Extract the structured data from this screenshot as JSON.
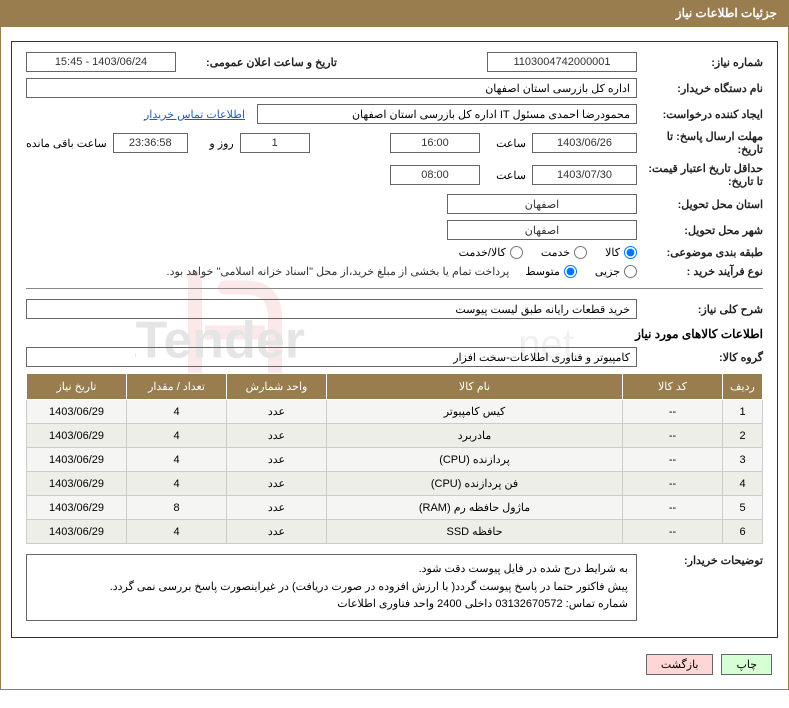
{
  "title_bar": "جزئیات اطلاعات نیاز",
  "labels": {
    "need_no": "شماره نیاز:",
    "announce_dt": "تاریخ و ساعت اعلان عمومی:",
    "buyer_org": "نام دستگاه خریدار:",
    "requester": "ایجاد کننده درخواست:",
    "contact_link": "اطلاعات تماس خریدار",
    "reply_deadline": "مهلت ارسال پاسخ: تا تاریخ:",
    "hour": "ساعت",
    "day_and": "روز و",
    "remaining": "ساعت باقی مانده",
    "price_valid": "حداقل تاریخ اعتبار قیمت: تا تاریخ:",
    "delivery_prov": "استان محل تحویل:",
    "delivery_city": "شهر محل تحویل:",
    "category": "طبقه بندی موضوعی:",
    "purchase_type": "نوع فرآیند خرید :",
    "purchase_note": "پرداخت تمام یا بخشی از مبلغ خرید،از محل \"اسناد خزانه اسلامی\" خواهد بود.",
    "general_desc": "شرح کلی نیاز:",
    "items_title": "اطلاعات کالاهای مورد نیاز",
    "goods_group": "گروه کالا:",
    "buyer_notes": "توضیحات خریدار:"
  },
  "values": {
    "need_no": "1103004742000001",
    "announce_dt": "1403/06/24 - 15:45",
    "buyer_org": "اداره کل بازرسی استان اصفهان",
    "requester": "محمودرضا احمدی مسئول IT اداره کل بازرسی استان اصفهان",
    "reply_date": "1403/06/26",
    "reply_hour": "16:00",
    "remain_days": "1",
    "remain_time": "23:36:58",
    "valid_date": "1403/07/30",
    "valid_hour": "08:00",
    "delivery_prov": "اصفهان",
    "delivery_city": "اصفهان",
    "general_desc": "خرید قطعات رایانه طبق لیست پیوست",
    "goods_group": "کامپیوتر و فناوری اطلاعات-سخت افزار"
  },
  "radios": {
    "category": {
      "options": [
        "کالا",
        "خدمت",
        "کالا/خدمت"
      ],
      "selected": 0
    },
    "purchase_type": {
      "options": [
        "جزیی",
        "متوسط"
      ],
      "selected": 1
    }
  },
  "table": {
    "headers": [
      "ردیف",
      "کد کالا",
      "نام کالا",
      "واحد شمارش",
      "تعداد / مقدار",
      "تاریخ نیاز"
    ],
    "rows": [
      {
        "n": "1",
        "code": "--",
        "name": "کیس کامپیوتر",
        "unit": "عدد",
        "qty": "4",
        "date": "1403/06/29"
      },
      {
        "n": "2",
        "code": "--",
        "name": "مادربرد",
        "unit": "عدد",
        "qty": "4",
        "date": "1403/06/29"
      },
      {
        "n": "3",
        "code": "--",
        "name": "پردازنده (CPU)",
        "unit": "عدد",
        "qty": "4",
        "date": "1403/06/29"
      },
      {
        "n": "4",
        "code": "--",
        "name": "فن پردازنده (CPU)",
        "unit": "عدد",
        "qty": "4",
        "date": "1403/06/29"
      },
      {
        "n": "5",
        "code": "--",
        "name": "ماژول حافظه رم (RAM)",
        "unit": "عدد",
        "qty": "8",
        "date": "1403/06/29"
      },
      {
        "n": "6",
        "code": "--",
        "name": "حافظه SSD",
        "unit": "عدد",
        "qty": "4",
        "date": "1403/06/29"
      }
    ]
  },
  "buyer_notes_lines": [
    "به شرایط درج شده در فایل پیوست دقت شود.",
    "پیش فاکتور حتما در پاسخ پیوست گردد( با ارزش افزوده در صورت دریافت) در غیراینصورت پاسخ بررسی نمی گردد.",
    "شماره تماس: 03132670572 داخلی 2400 واحد فناوری اطلاعات"
  ],
  "buttons": {
    "print": "چاپ",
    "back": "بازگشت"
  },
  "watermark_text": "AriaTender.net"
}
